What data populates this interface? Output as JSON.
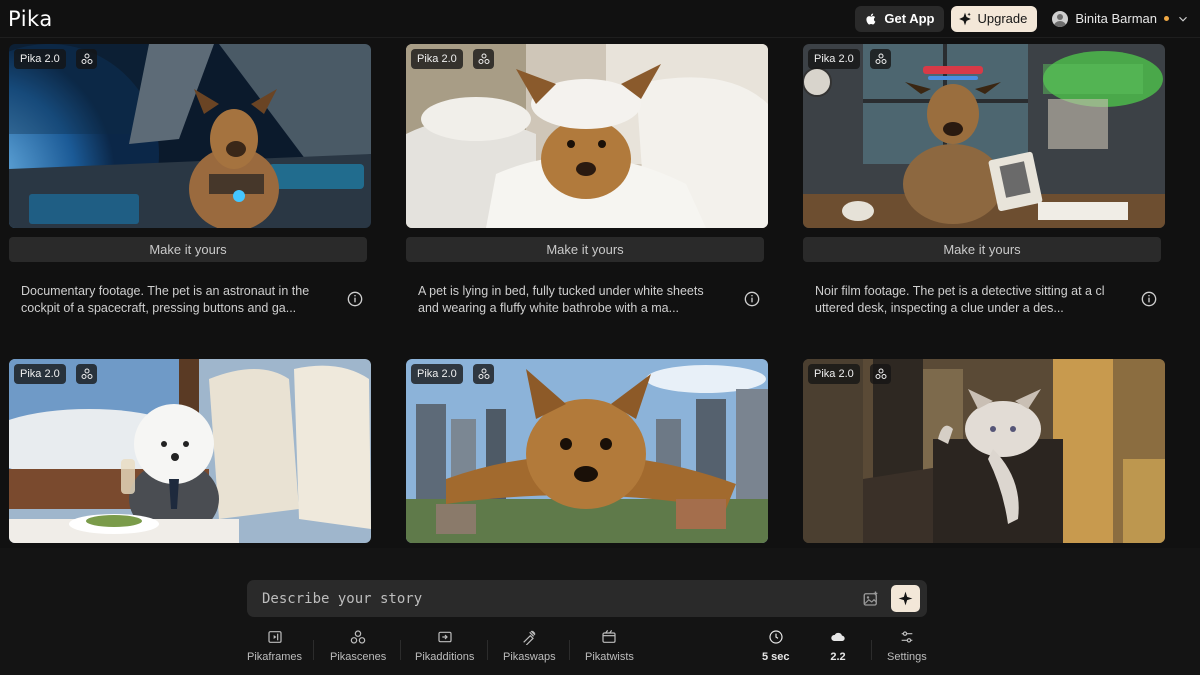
{
  "app": {
    "logo": "Pika"
  },
  "header": {
    "get_app_label": "Get App",
    "upgrade_label": "Upgrade",
    "user_name": "Binita Barman",
    "apple_icon": "apple-icon",
    "sparkle_icon": "sparkle-icon",
    "status_dot_color": "#f0a844"
  },
  "cards": [
    {
      "model": "Pika 2.0",
      "action": "Make it yours",
      "desc_line1": "Documentary footage. The pet is an astronaut in the",
      "desc_line2": "cockpit of a spacecraft, pressing buttons and ga...",
      "scene": "dog astronaut in spacecraft cockpit"
    },
    {
      "model": "Pika 2.0",
      "action": "Make it yours",
      "desc_line1": "A pet is lying in bed, fully tucked under white sheets",
      "desc_line2": "and wearing a fluffy white bathrobe with a ma...",
      "scene": "dog in bathrobe in bed"
    },
    {
      "model": "Pika 2.0",
      "action": "Make it yours",
      "desc_line1": "Noir film footage. The pet is a detective sitting at a cl",
      "desc_line2": "uttered desk, inspecting a clue under a des...",
      "scene": "dog detective at desk"
    },
    {
      "model": "Pika 2.0",
      "scene": "dog in suit on airplane"
    },
    {
      "model": "Pika 2.0",
      "scene": "giant dog over city"
    },
    {
      "model": "Pika 2.0",
      "scene": "cat on skyscraper"
    }
  ],
  "prompt": {
    "placeholder": "Describe your story"
  },
  "toolbar": {
    "items": [
      {
        "label": "Pikaframes",
        "icon": "frames-icon"
      },
      {
        "label": "Pikascenes",
        "icon": "scenes-icon"
      },
      {
        "label": "Pikadditions",
        "icon": "additions-icon"
      },
      {
        "label": "Pikaswaps",
        "icon": "swaps-icon"
      },
      {
        "label": "Pikatwists",
        "icon": "twists-icon"
      }
    ],
    "duration": "5 sec",
    "model_version": "2.2",
    "settings_label": "Settings"
  }
}
